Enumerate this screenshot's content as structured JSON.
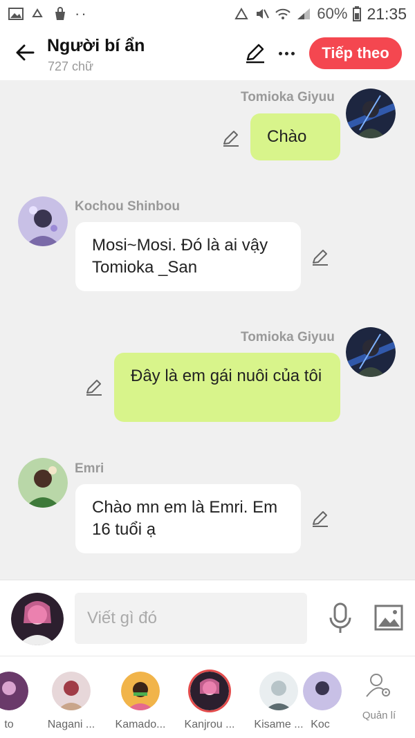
{
  "status": {
    "battery": "60%",
    "time": "21:35"
  },
  "header": {
    "title": "Người bí ẩn",
    "subtitle": "727 chữ",
    "next_label": "Tiếp theo"
  },
  "messages": [
    {
      "side": "right",
      "name": "Tomioka Giyuu",
      "text": "Chào"
    },
    {
      "side": "left",
      "name": "Kochou Shinbou",
      "text": "Mosi~Mosi. Đó là ai vậy Tomioka _San"
    },
    {
      "side": "right",
      "name": "Tomioka Giyuu",
      "text": "Đây là em gái nuôi của tôi"
    },
    {
      "side": "left",
      "name": "Emri",
      "text": "Chào mn em là Emri. Em 16 tuổi ạ"
    }
  ],
  "composer": {
    "placeholder": "Viết gì đó"
  },
  "characters": [
    {
      "label": "to"
    },
    {
      "label": "Nagani ..."
    },
    {
      "label": "Kamado..."
    },
    {
      "label": "Kanjrou ..."
    },
    {
      "label": "Kisame ..."
    },
    {
      "label": "Koc"
    }
  ],
  "manage_label": "Quản lí",
  "colors": {
    "accent": "#f44750",
    "bubble_right": "#d8f48b",
    "bubble_left": "#ffffff",
    "background": "#f0f0f0"
  }
}
